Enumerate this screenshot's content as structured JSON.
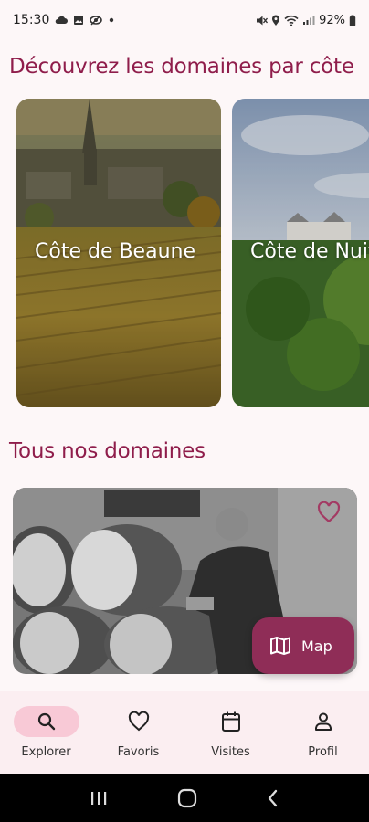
{
  "status_bar": {
    "time": "15:30",
    "battery": "92%",
    "icons": [
      "cloud-icon",
      "image-icon",
      "eye-off-icon",
      "dot-icon",
      "mute-icon",
      "location-icon",
      "wifi-icon",
      "signal-icon",
      "battery-icon"
    ]
  },
  "cotes_section": {
    "title": "Découvrez les domaines par côte",
    "cards": [
      {
        "label": "Côte de Beaune"
      },
      {
        "label": "Côte de Nuits"
      }
    ]
  },
  "domaines_section": {
    "title": "Tous nos domaines"
  },
  "map_button": {
    "label": "Map"
  },
  "bottom_nav": {
    "items": [
      {
        "label": "Explorer",
        "icon": "search-icon",
        "active": true
      },
      {
        "label": "Favoris",
        "icon": "heart-icon",
        "active": false
      },
      {
        "label": "Visites",
        "icon": "calendar-icon",
        "active": false
      },
      {
        "label": "Profil",
        "icon": "person-icon",
        "active": false
      }
    ]
  },
  "colors": {
    "accent": "#8f1d4b",
    "fab": "#8f2d57",
    "nav_background": "#fbeef1",
    "nav_active_pill": "#f8c9d6"
  }
}
